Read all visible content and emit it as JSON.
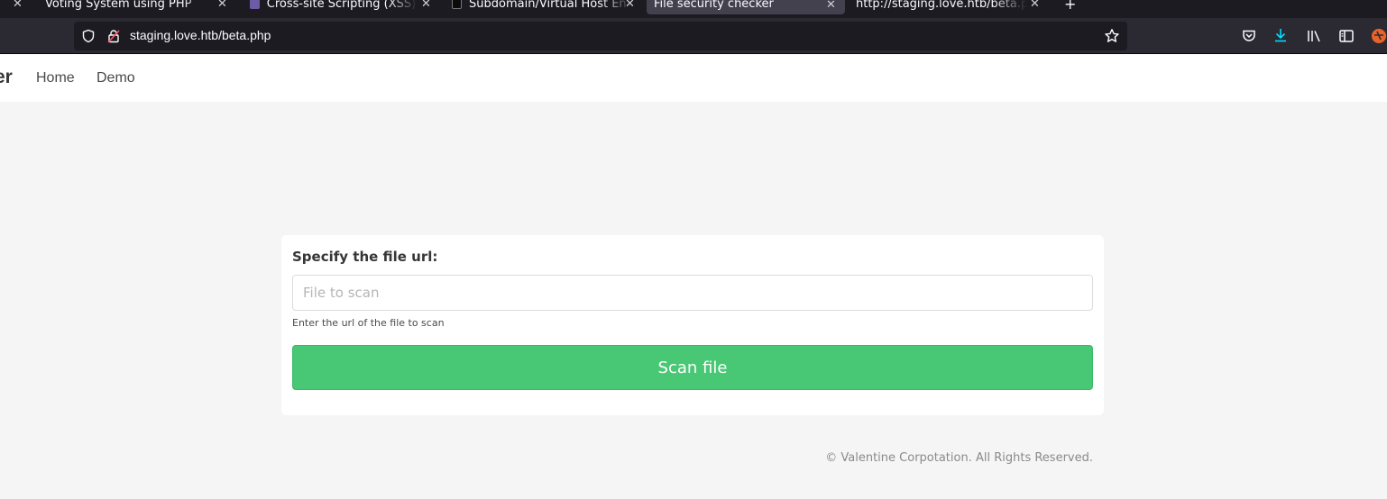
{
  "browser": {
    "tabs": [
      {
        "title": "Voting System using PHP",
        "active": false
      },
      {
        "title": "Cross-site Scripting (XSS) in",
        "active": false
      },
      {
        "title": "Subdomain/Virtual Host En",
        "active": false
      },
      {
        "title": "File security checker",
        "active": true
      },
      {
        "title": "http://staging.love.htb/beta.ph",
        "active": false
      }
    ],
    "new_tab_label": "+",
    "url": "staging.love.htb/beta.php"
  },
  "navbar": {
    "brand": "er",
    "links": [
      "Home",
      "Demo"
    ]
  },
  "form": {
    "label": "Specify the file url:",
    "input_placeholder": "File to scan",
    "input_value": "",
    "help": "Enter the url of the file to scan",
    "button": "Scan file"
  },
  "footer": "© Valentine Corpotation. All Rights Reserved.",
  "colors": {
    "accent": "#48c774",
    "download_icon": "#00ddff"
  }
}
